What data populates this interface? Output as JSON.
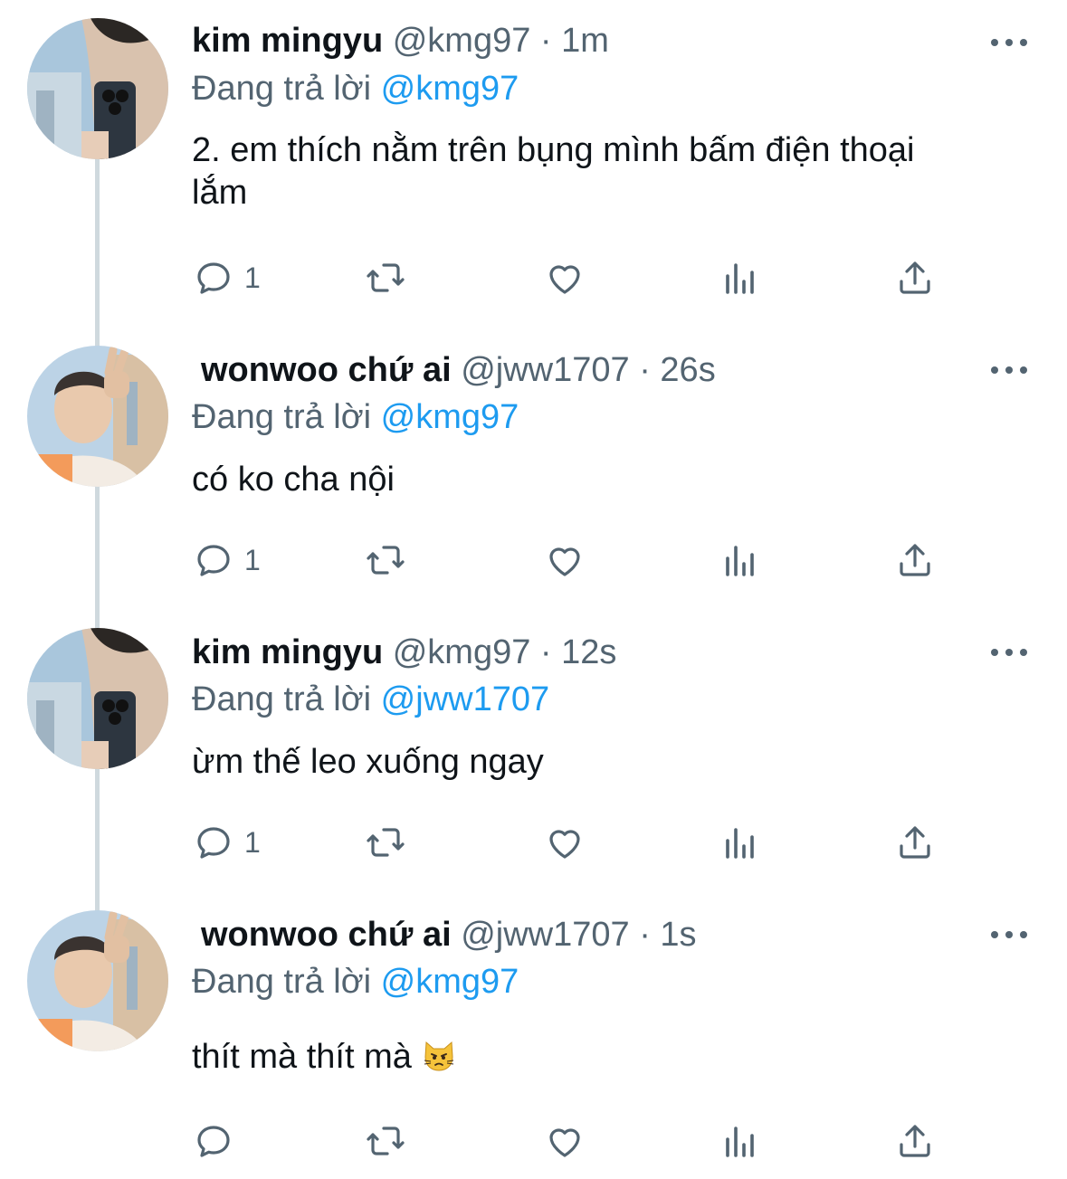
{
  "tweets": [
    {
      "name": "kim mingyu",
      "handle": "@kmg97",
      "time": "1m",
      "reply_prefix": "Đang trả lời",
      "reply_to": "@kmg97",
      "text": "2. em thích nằm trên bụng mình bấm điện thoại lắm",
      "reply_count": "1",
      "avatar": "mingyu-mirror-selfie"
    },
    {
      "name": "wonwoo chứ ai",
      "handle": "@jww1707",
      "time": "26s",
      "reply_prefix": "Đang trả lời",
      "reply_to": "@kmg97",
      "text": "có ko cha nội",
      "reply_count": "1",
      "avatar": "wonwoo-peace-sign"
    },
    {
      "name": "kim mingyu",
      "handle": "@kmg97",
      "time": "12s",
      "reply_prefix": "Đang trả lời",
      "reply_to": "@jww1707",
      "text": "ừm thế leo xuống ngay",
      "reply_count": "1",
      "avatar": "mingyu-mirror-selfie"
    },
    {
      "name": "wonwoo chứ ai",
      "handle": "@jww1707",
      "time": "1s",
      "reply_prefix": "Đang trả lời",
      "reply_to": "@kmg97",
      "text": "thít mà thít mà",
      "reply_count": "",
      "avatar": "wonwoo-peace-sign",
      "emoji": "pouting-cat-emoji"
    }
  ],
  "separator": "·",
  "icons": {
    "reply": "reply-icon",
    "retweet": "retweet-icon",
    "like": "heart-icon",
    "views": "views-icon",
    "share": "share-icon",
    "more": "more-icon"
  },
  "colors": {
    "text": "#0f1419",
    "secondary": "#536471",
    "link": "#1d9bf0",
    "thread_line": "#cfd9de"
  }
}
